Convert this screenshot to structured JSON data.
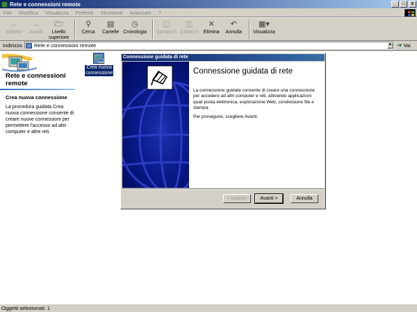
{
  "window": {
    "title": "Rete e connessioni remote",
    "buttons": [
      "minimize",
      "maximize",
      "close"
    ]
  },
  "menu": [
    "File",
    "Modifica",
    "Visualizza",
    "Preferiti",
    "Strumenti",
    "Avanzate",
    "?"
  ],
  "toolbar": {
    "back": "Indietro",
    "forward": "Avanti",
    "up_line1": "Livello",
    "up_line2": "superiore",
    "search": "Cerca",
    "folders": "Cartelle",
    "history": "Cronologia",
    "move": "Sposta in",
    "copy": "Copia in",
    "delete": "Elimina",
    "undo": "Annulla",
    "view": "Visualizza"
  },
  "address": {
    "label": "Indirizzo",
    "value": "Rete e connessioni remote",
    "go": "Vai"
  },
  "left_panel": {
    "title_line1": "Rete e connessioni",
    "title_line2": "remote",
    "section_title": "Crea nuova connessione",
    "section_text": "La procedura guidata Crea nuova connessione consente di creare nuove connessioni per permettere l'accesso ad altri computer e altre reti."
  },
  "desktop_icon": {
    "line1": "Crea nuova",
    "line2": "connessione"
  },
  "wizard": {
    "title": "Connessione guidata di rete",
    "heading": "Connessione guidata di rete",
    "body": "La connessione guidata consente di creare una connessione per accedere ad altri computer e reti, attivando applicazioni quali posta elettronica, esplorazione Web, condivisione file e stampa.",
    "prompt": "Per proseguire, scegliere Avanti.",
    "back_button": "< Indietro",
    "next_button": "Avanti >",
    "cancel_button": "Annulla"
  },
  "status": {
    "text": "Oggetti selezionati: 1"
  }
}
